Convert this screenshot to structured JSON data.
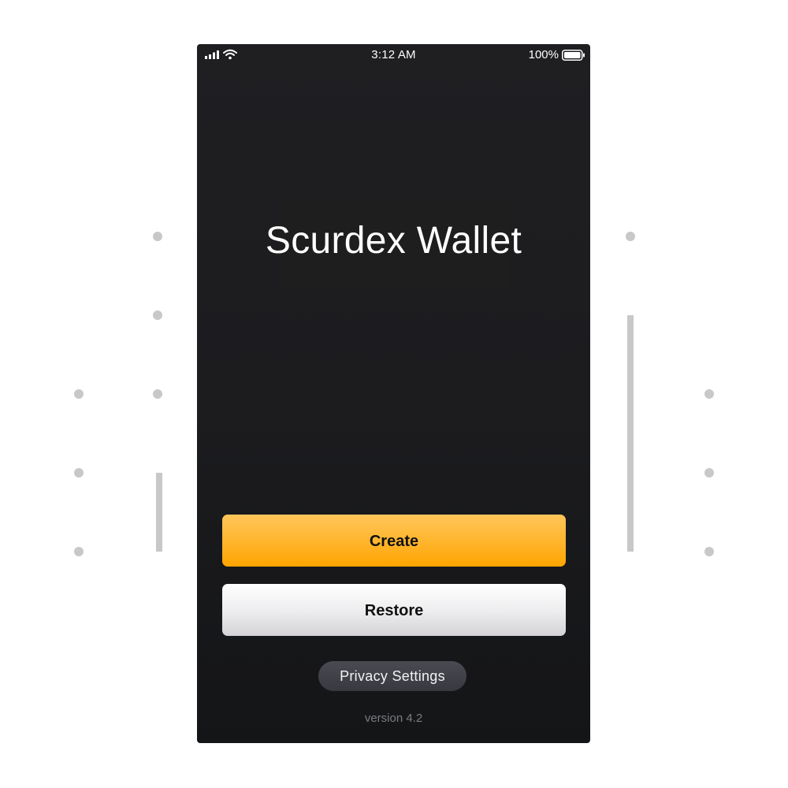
{
  "status_bar": {
    "time": "3:12 AM",
    "battery_percent": "100%",
    "icons": [
      "signal-icon",
      "wifi-icon",
      "battery-icon"
    ],
    "battery_level": 1.0
  },
  "app": {
    "title": "Scurdex Wallet"
  },
  "actions": {
    "create_label": "Create",
    "restore_label": "Restore",
    "privacy_label": "Privacy Settings"
  },
  "footer": {
    "version": "version 4.2"
  },
  "colors": {
    "background": "#ffffff",
    "phone_background": "#1c1c1f",
    "accent": "#ffb42a",
    "restore_button": "#ececee",
    "privacy_button": "#404148",
    "version_text": "#7c7c80",
    "decoration": "#c8c8c8"
  }
}
